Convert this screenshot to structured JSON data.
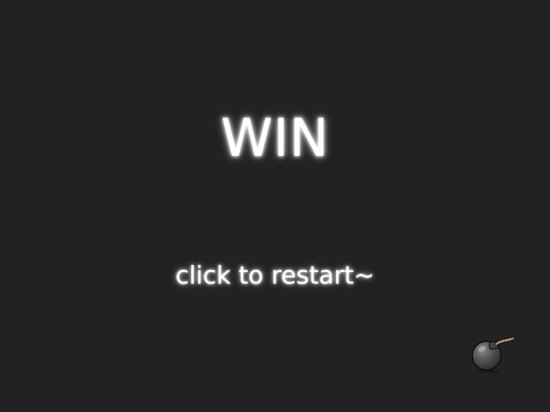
{
  "game": {
    "result_text": "WIN",
    "restart_hint": "click to restart~",
    "cursor_icon": "bomb-icon"
  },
  "colors": {
    "background": "#222222",
    "text": "#ffffff",
    "glow": "#ffffff",
    "bomb_body": "#5a5a5a",
    "bomb_fuse": "#b08a62"
  }
}
